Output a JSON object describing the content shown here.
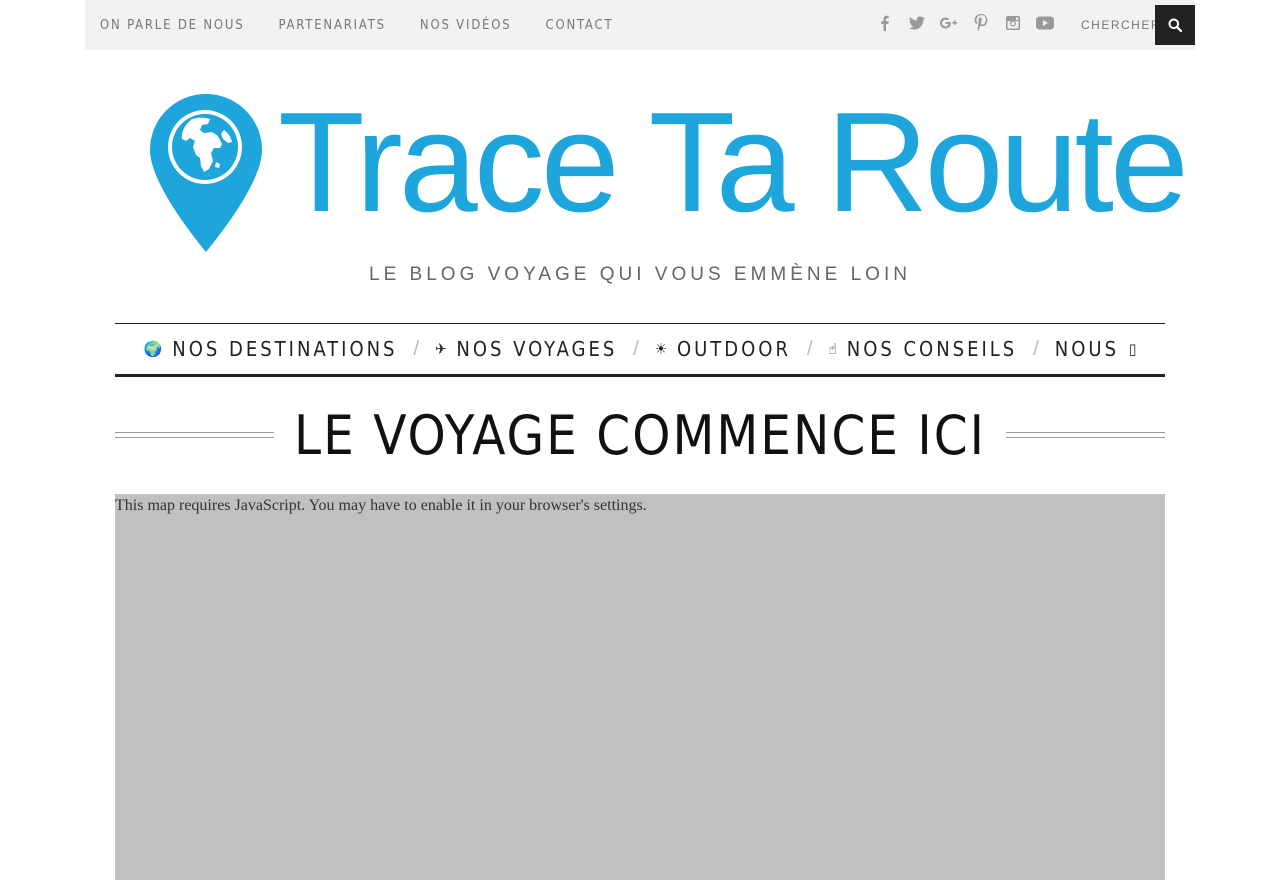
{
  "topbar": {
    "links": [
      "ON PARLE DE NOUS",
      "PARTENARIATS",
      "NOS VIDÉOS",
      "CONTACT"
    ],
    "social_icons": [
      "facebook-icon",
      "twitter-icon",
      "google-plus-icon",
      "pinterest-icon",
      "instagram-icon",
      "youtube-icon"
    ],
    "search_placeholder": "CHERCHER"
  },
  "logo": {
    "title": "Trace Ta Route",
    "color": "#1ea5dc"
  },
  "tagline": "LE BLOG VOYAGE QUI VOUS EMMÈNE LOIN",
  "mainnav": {
    "items": [
      {
        "label": "NOS DESTINATIONS",
        "icon": "🌍"
      },
      {
        "label": "NOS VOYAGES",
        "icon": "✈"
      },
      {
        "label": "OUTDOOR",
        "icon": "☀"
      },
      {
        "label": "NOS CONSEILS",
        "icon": "☝"
      },
      {
        "label": "NOUS",
        "icon": "▯"
      }
    ]
  },
  "heading": "LE VOYAGE COMMENCE ICI",
  "map": {
    "message": "This map requires JavaScript. You may have to enable it in your browser's settings.",
    "background": "#c0c0c0"
  }
}
